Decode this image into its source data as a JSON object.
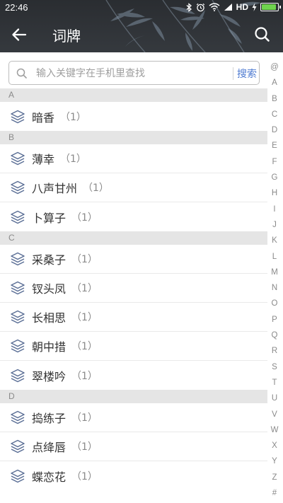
{
  "status_bar": {
    "time": "22:46",
    "network_label": "HD",
    "battery_level": 0.9,
    "icons": [
      "bluetooth-icon",
      "alarm-icon",
      "wifi-icon",
      "signal-icon",
      "charging-icon",
      "battery-icon"
    ]
  },
  "toolbar": {
    "title": "词牌",
    "back_icon": "back-arrow-icon",
    "search_icon": "search-icon"
  },
  "search": {
    "placeholder": "输入关键字在手机里查找",
    "value": "",
    "button_label": "搜索"
  },
  "sections": [
    {
      "letter": "A",
      "items": [
        {
          "name": "暗香",
          "count": "（1）"
        }
      ]
    },
    {
      "letter": "B",
      "items": [
        {
          "name": "薄幸",
          "count": "（1）"
        },
        {
          "name": "八声甘州",
          "count": "（1）"
        },
        {
          "name": "卜算子",
          "count": "（1）"
        }
      ]
    },
    {
      "letter": "C",
      "items": [
        {
          "name": "采桑子",
          "count": "（1）"
        },
        {
          "name": "钗头凤",
          "count": "（1）"
        },
        {
          "name": "长相思",
          "count": "（1）"
        },
        {
          "name": "朝中措",
          "count": "（1）"
        },
        {
          "name": "翠楼吟",
          "count": "（1）"
        }
      ]
    },
    {
      "letter": "D",
      "items": [
        {
          "name": "捣练子",
          "count": "（1）"
        },
        {
          "name": "点绛唇",
          "count": "（1）"
        },
        {
          "name": "蝶恋花",
          "count": "（1）"
        }
      ]
    }
  ],
  "alpha_index": [
    "@",
    "A",
    "B",
    "C",
    "D",
    "E",
    "F",
    "G",
    "H",
    "I",
    "J",
    "K",
    "L",
    "M",
    "N",
    "O",
    "P",
    "Q",
    "R",
    "S",
    "T",
    "U",
    "V",
    "W",
    "X",
    "Y",
    "Z",
    "#"
  ],
  "colors": {
    "toolbar_bg": "#2f3236",
    "accent": "#4f7bd1",
    "section_bg": "#e5e5e5",
    "battery": "#6fd34e"
  }
}
